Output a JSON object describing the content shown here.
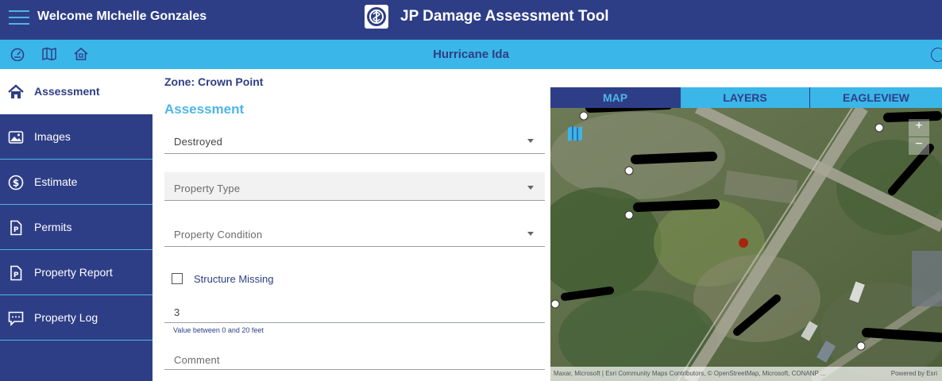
{
  "header": {
    "welcome": "Welcome MIchelle Gonzales",
    "app_title": "JP Damage Assessment Tool"
  },
  "subheader": {
    "event": "Hurricane Ida",
    "icons": [
      "dashboard-icon",
      "map-icon",
      "home-icon"
    ]
  },
  "sidebar": {
    "items": [
      {
        "label": "Assessment",
        "icon": "home-icon",
        "active": true
      },
      {
        "label": "Images",
        "icon": "image-icon"
      },
      {
        "label": "Estimate",
        "icon": "dollar-icon"
      },
      {
        "label": "Permits",
        "icon": "document-icon"
      },
      {
        "label": "Property Report",
        "icon": "document-icon"
      },
      {
        "label": "Property Log",
        "icon": "chat-icon"
      }
    ]
  },
  "form": {
    "zone": "Zone: Crown Point",
    "section_title": "Assessment",
    "damage_level": {
      "value": "Destroyed"
    },
    "property_type": {
      "placeholder": "Property Type"
    },
    "property_condition": {
      "placeholder": "Property Condition"
    },
    "structure_missing": {
      "label": "Structure Missing",
      "checked": false
    },
    "water_depth": {
      "value": "3",
      "helper": "Value between 0 and 20 feet"
    },
    "comment": {
      "placeholder": "Comment"
    }
  },
  "map": {
    "tabs": [
      {
        "label": "MAP",
        "active": true
      },
      {
        "label": "LAYERS"
      },
      {
        "label": "EAGLEVIEW"
      }
    ],
    "zoom_in": "+",
    "zoom_out": "−",
    "attribution": "Maxar, Microsoft | Esri Community Maps Contributors, © OpenStreetMap, Microsoft, CONANP ...",
    "powered_by": "Powered by Esri"
  },
  "colors": {
    "navy": "#2e3e86",
    "sky": "#3bb6e8",
    "accent": "#4db5e8",
    "marker": "#a8240c"
  }
}
